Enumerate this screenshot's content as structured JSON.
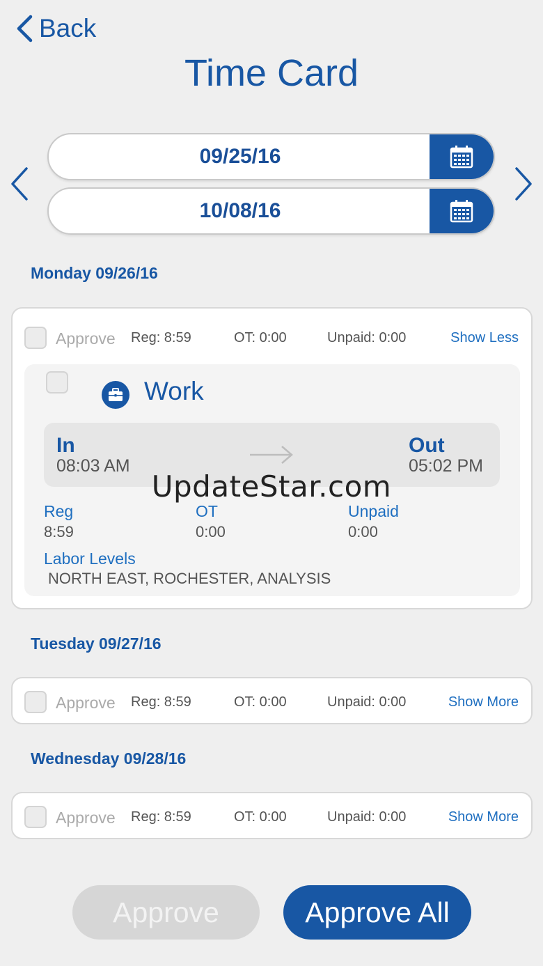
{
  "header": {
    "back_label": "Back",
    "title": "Time Card"
  },
  "date_range": {
    "start": "09/25/16",
    "end": "10/08/16"
  },
  "days": [
    {
      "heading": "Monday 09/26/16",
      "approve_label": "Approve",
      "reg": "Reg: 8:59",
      "ot": "OT: 0:00",
      "unpaid": "Unpaid: 0:00",
      "toggle": "Show Less",
      "expanded": true,
      "detail": {
        "type": "Work",
        "in_label": "In",
        "in_time": "08:03 AM",
        "out_label": "Out",
        "out_time": "05:02 PM",
        "reg_label": "Reg",
        "reg_value": "8:59",
        "ot_label": "OT",
        "ot_value": "0:00",
        "unpaid_label": "Unpaid",
        "unpaid_value": "0:00",
        "labor_label": "Labor Levels",
        "labor_value": "NORTH EAST, ROCHESTER, ANALYSIS"
      }
    },
    {
      "heading": "Tuesday 09/27/16",
      "approve_label": "Approve",
      "reg": "Reg: 8:59",
      "ot": "OT: 0:00",
      "unpaid": "Unpaid: 0:00",
      "toggle": "Show More",
      "expanded": false
    },
    {
      "heading": "Wednesday 09/28/16",
      "approve_label": "Approve",
      "reg": "Reg: 8:59",
      "ot": "OT: 0:00",
      "unpaid": "Unpaid: 0:00",
      "toggle": "Show More",
      "expanded": false
    }
  ],
  "watermark": "UpdateStar.com",
  "footer": {
    "approve_label": "Approve",
    "approve_all_label": "Approve All"
  },
  "icons": {
    "back": "chevron-left-icon",
    "prev": "chevron-left-icon",
    "next": "chevron-right-icon",
    "calendar": "calendar-icon",
    "work": "briefcase-icon",
    "arrow": "arrow-right-icon"
  },
  "colors": {
    "brand": "#1857a4",
    "link": "#1f6fc0",
    "background": "#efefef",
    "disabled_button": "#d6d6d6"
  }
}
